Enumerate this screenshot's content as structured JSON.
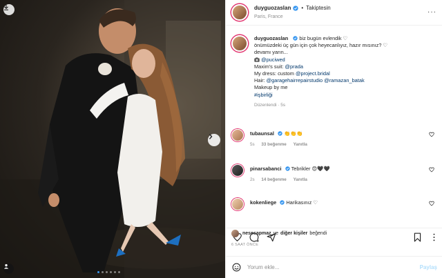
{
  "post": {
    "username": "duyguozaslan",
    "follow_status": "Takiptesin",
    "location": "Paris, France",
    "caption_lines": [
      "biz bugün evlendik ♡",
      "önümüzdeki üç gün için çok heyecanlıyız, hazır mısınız? ♡",
      "devamı yarın...",
      "@puciwed",
      "Maxim's suit:",
      "@prada",
      "My dress: custom",
      "@project.bridal",
      "Hair:",
      "@garagehairrepairstudio",
      "@ramazan_batak",
      "Makeup by me",
      "#işbirliği"
    ],
    "caption_meta": "Düzenlendi · 5s"
  },
  "comments": [
    {
      "username": "tubaunsal",
      "text": "👏👏👏",
      "age": "5s",
      "likes": "33 beğenme",
      "reply": "Yanıtla"
    },
    {
      "username": "pinarsabanci",
      "text": "Tebrikler 😍🖤🖤",
      "age": "2s",
      "likes": "14 beğenme",
      "reply": "Yanıtla"
    },
    {
      "username": "kokenliege",
      "text": "Harikasınız ♡"
    }
  ],
  "likes": {
    "liker": "nesesapmaz",
    "connector": "ve",
    "others": "diğer kişiler",
    "suffix": "beğendi"
  },
  "timestamp": "6 SAAT ÖNCE",
  "add_comment": {
    "placeholder": "Yorum ekle...",
    "post_label": "Paylaş"
  },
  "icons": {
    "verified": "verified-badge-icon",
    "heart": "heart-icon",
    "comment": "comment-icon",
    "share": "share-icon",
    "save": "bookmark-icon",
    "emoji": "emoji-icon",
    "more": "more-options-icon"
  },
  "colors": {
    "verified": "#3897f0",
    "link": "#00376b",
    "post_disabled": "#b2dffc",
    "meta": "#8e8e8e"
  },
  "carousel": {
    "slides": 6,
    "active_index": 0
  }
}
